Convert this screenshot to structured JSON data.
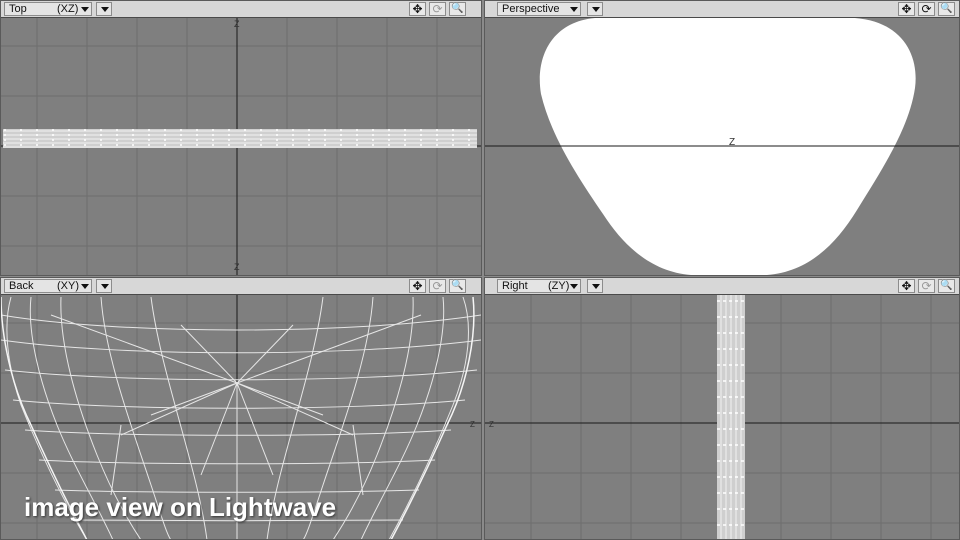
{
  "viewports": {
    "top": {
      "view": "Top",
      "axis": "(XZ)",
      "axis_marker": "Z"
    },
    "perspective": {
      "view": "Perspective",
      "axis_marker": "Z"
    },
    "back": {
      "view": "Back",
      "axis": "(XY)",
      "axis_marker": "Z"
    },
    "right": {
      "view": "Right",
      "axis": "(ZY)",
      "axis_marker": "Z"
    }
  },
  "tools": {
    "move": "✥",
    "rotate": "⟳",
    "zoom": "🔍"
  },
  "caption": "image view on Lightwave",
  "colors": {
    "grid_background": "#7f7f7f",
    "grid_line": "#6e6e6e",
    "axis_line": "#1a1a1a",
    "mesh": "#e6e6e6",
    "header": "#d7d7d7"
  }
}
